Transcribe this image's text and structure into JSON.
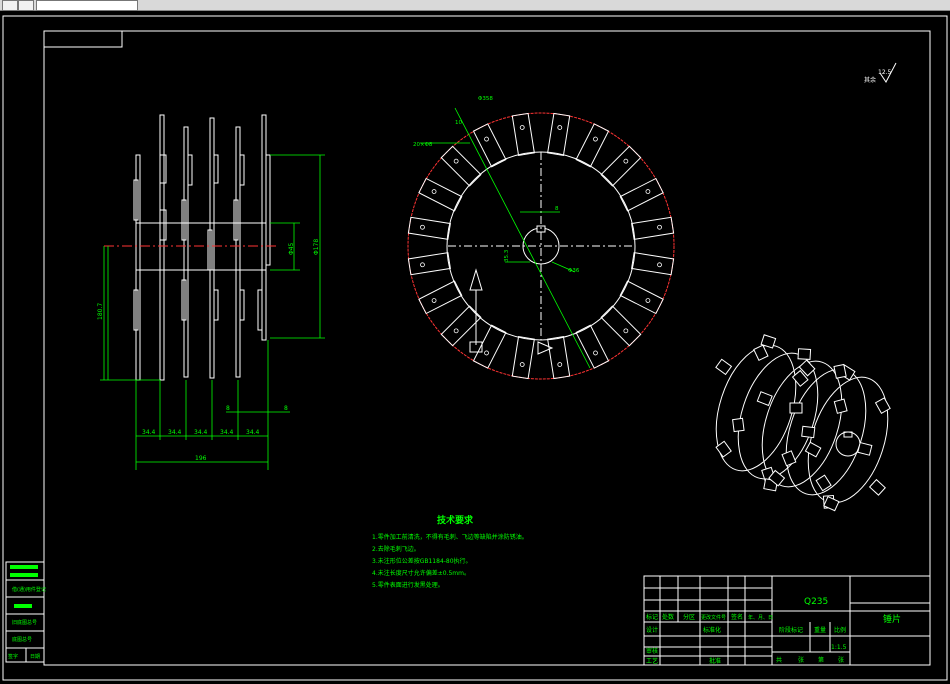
{
  "app": {
    "window_title": ""
  },
  "drawing": {
    "material": "Q235",
    "part_name": "锤片",
    "scale": "1:1.5",
    "roughness_note": "其余",
    "roughness_value": "12.5",
    "tech_title": "技术要求",
    "tech_notes": [
      "1.零件加工前清洗，不得有毛刺、飞边等缺陷并涂防锈油。",
      "2.去除毛刺飞边。",
      "3.未注形位公差按GB1184-80执行。",
      "4.未注长度尺寸允许偏差±0.5mm。",
      "5.零件表面进行发黑处理。"
    ],
    "dims": {
      "overall_length": "196",
      "spacing": [
        "34.4",
        "34.4",
        "34.4",
        "34.4",
        "34.4"
      ],
      "height_left": "180.7",
      "dia_right": "Φ178",
      "dia_small": "Φ45",
      "thickness_a": "8",
      "thickness_b": "8",
      "outer_dia": "Φ358",
      "hole_note": "20×Φ8",
      "key_width": "8",
      "key_depth": "35.3",
      "bore": "Φ36",
      "tip": "10"
    },
    "title_block": {
      "row1": [
        "标记",
        "处数",
        "分区",
        "更改文件号",
        "签名",
        "年、月、日"
      ],
      "row2": [
        "设计",
        "",
        "",
        "标准化",
        ""
      ],
      "row3": [
        "审核",
        "",
        "",
        "",
        ""
      ],
      "row4": [
        "工艺",
        "",
        "",
        "批准",
        ""
      ],
      "stage_labels": [
        "阶段标记",
        "重量",
        "比例"
      ],
      "sheet_labels": [
        "共",
        "张",
        "第",
        "张"
      ]
    },
    "left_strip": [
      "借(通)用件登记",
      "",
      "旧底图总号",
      "",
      "底图总号",
      "签字",
      "日期"
    ]
  }
}
